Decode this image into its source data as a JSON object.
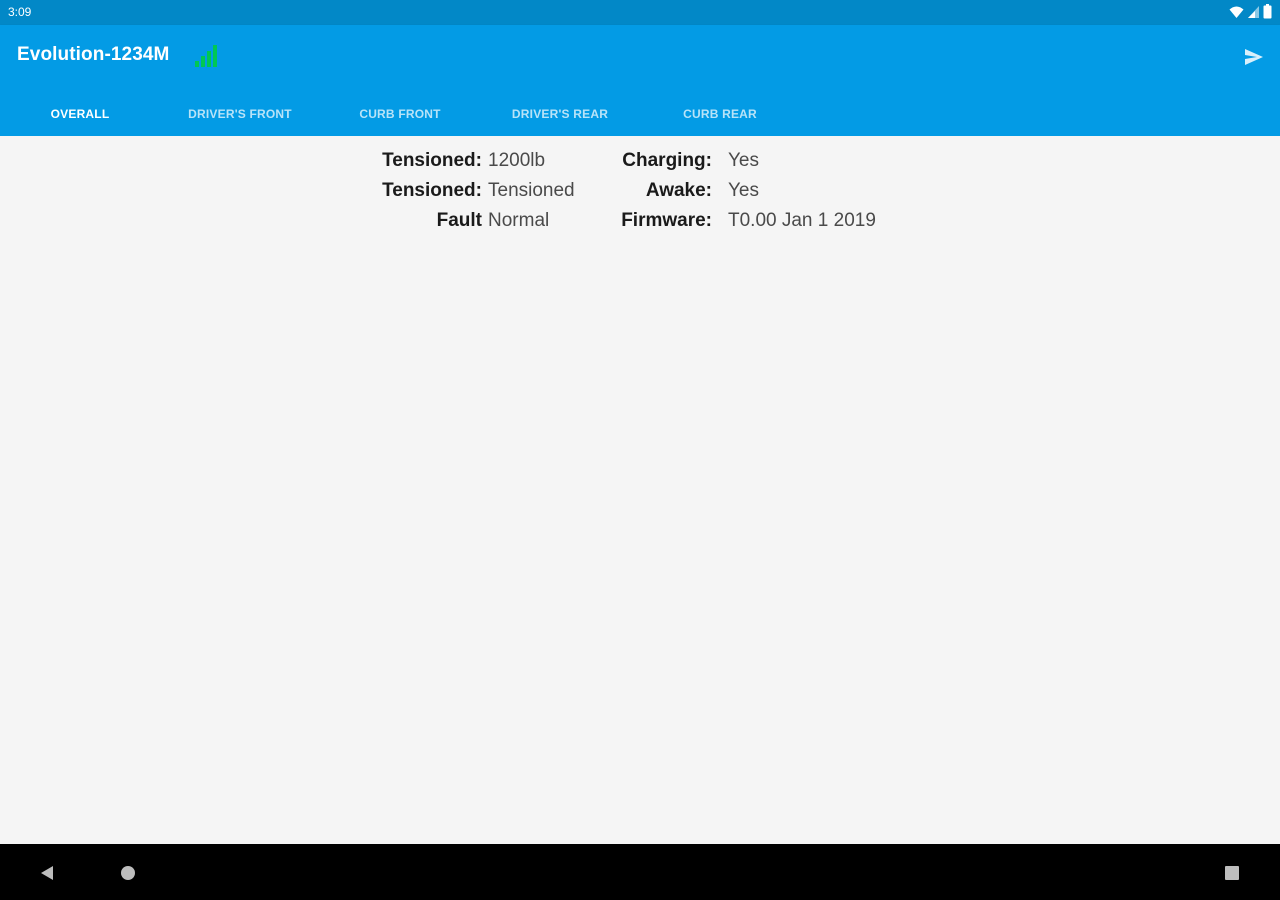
{
  "status_bar": {
    "time": "3:09",
    "icons": [
      "wifi-icon",
      "cell-signal-icon",
      "battery-icon"
    ]
  },
  "app_bar": {
    "title": "Evolution-1234M",
    "signal_icon": "signal-strength-icon",
    "signal_color": "#00c853",
    "action_icon": "send-icon"
  },
  "tabs": [
    {
      "label": "OVERALL",
      "active": true
    },
    {
      "label": "DRIVER'S FRONT",
      "active": false
    },
    {
      "label": "CURB FRONT",
      "active": false
    },
    {
      "label": "DRIVER'S REAR",
      "active": false
    },
    {
      "label": "CURB REAR",
      "active": false
    }
  ],
  "overview": {
    "rows": [
      {
        "left_label": "Tensioned:",
        "left_value": "1200lb",
        "right_label": "Charging:",
        "right_value": "Yes"
      },
      {
        "left_label": "Tensioned:",
        "left_value": "Tensioned",
        "right_label": "Awake:",
        "right_value": "Yes"
      },
      {
        "left_label": "Fault",
        "left_value": "Normal",
        "right_label": "Firmware:",
        "right_value": "T0.00 Jan 1 2019"
      }
    ]
  },
  "nav_bar": {
    "icons": [
      "back-icon",
      "home-icon",
      "recents-icon"
    ]
  },
  "colors": {
    "status_bar": "#0288c7",
    "app_bar": "#039be5",
    "background": "#f5f5f5"
  }
}
